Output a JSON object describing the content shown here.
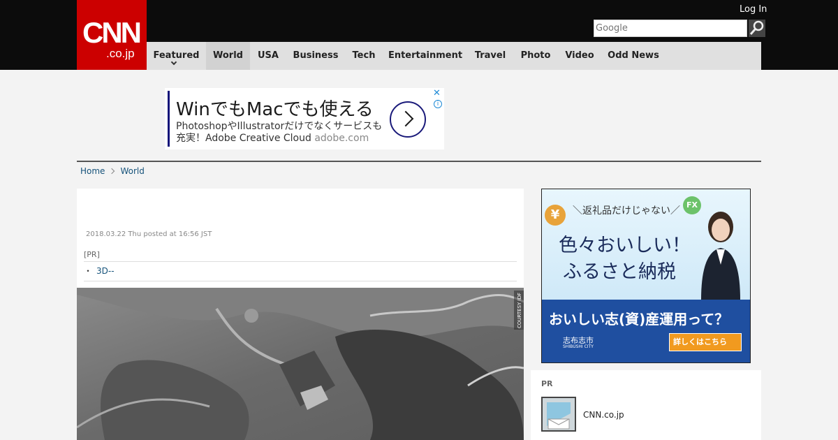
{
  "header": {
    "logo_main": "CNN",
    "logo_sub": ".co.jp",
    "login_label": "Log In",
    "search_placeholder": "Google"
  },
  "nav": {
    "items": [
      {
        "label": "Featured"
      },
      {
        "label": "World"
      },
      {
        "label": "USA"
      },
      {
        "label": "Business"
      },
      {
        "label": "Tech"
      },
      {
        "label": "Entertainment"
      },
      {
        "label": "Travel"
      },
      {
        "label": "Photo"
      },
      {
        "label": "Video"
      },
      {
        "label": "Odd News"
      }
    ],
    "active": "World"
  },
  "top_ad": {
    "headline": "WinでもMacでも使える",
    "line1": "PhotoshopやIllustratorだけでなくサービスも",
    "line2": "充実！Adobe Creative Cloud",
    "domain": "adobe.com"
  },
  "breadcrumb": {
    "home": "Home",
    "section": "World"
  },
  "article": {
    "posted": "2018.03.22 Thu posted at 16:56 JST",
    "pr_label": "[PR]",
    "pr_link": "3D--",
    "photo_credit": "COURTESY IDF"
  },
  "side_ad": {
    "tagline": "＼返礼品だけじゃない／",
    "headline1": "色々おいしい！",
    "headline2": "ふるさと納税",
    "question": "おいしい志(資)産運用って？",
    "city": "志布志市",
    "city_en": "SHIBUSHI CITY",
    "button": "詳しくはこちら",
    "coin_yen": "¥",
    "coin_fx": "FX"
  },
  "pr_box": {
    "label": "PR",
    "item_title": "CNN.co.jp"
  },
  "colors": {
    "brand_red": "#cc0000",
    "header_bg": "#0c0c0c",
    "nav_bg": "#e0e0e0",
    "link": "#15527a"
  }
}
